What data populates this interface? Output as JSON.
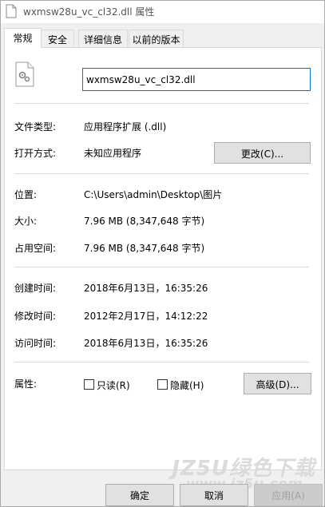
{
  "window": {
    "title": "wxmsw28u_vc_cl32.dll 属性"
  },
  "tabs": [
    {
      "label": "常规"
    },
    {
      "label": "安全"
    },
    {
      "label": "详细信息"
    },
    {
      "label": "以前的版本"
    }
  ],
  "general": {
    "file_name": "wxmsw28u_vc_cl32.dll",
    "file_type_label": "文件类型:",
    "file_type_value": "应用程序扩展 (.dll)",
    "open_with_label": "打开方式:",
    "open_with_value": "未知应用程序",
    "change_button": "更改(C)...",
    "location_label": "位置:",
    "location_value": "C:\\Users\\admin\\Desktop\\图片",
    "size_label": "大小:",
    "size_value": "7.96 MB (8,347,648 字节)",
    "size_on_disk_label": "占用空间:",
    "size_on_disk_value": "7.96 MB (8,347,648 字节)",
    "created_label": "创建时间:",
    "created_value": "2018年6月13日，16:35:26",
    "modified_label": "修改时间:",
    "modified_value": "2012年2月17日，14:12:22",
    "accessed_label": "访问时间:",
    "accessed_value": "2018年6月13日，16:35:26",
    "attributes_label": "属性:",
    "readonly_label": "只读(R)",
    "hidden_label": "隐藏(H)",
    "advanced_button": "高级(D)..."
  },
  "footer": {
    "ok_button": "确定",
    "cancel_button": "取消",
    "apply_button": "应用(A)"
  },
  "watermark": {
    "brand": "JZ5U绿色下载",
    "url": "www.jz5u.com"
  },
  "colors": {
    "accent_border": "#0078d7",
    "window_bg": "#f0f0f0",
    "panel_bg": "#ffffff"
  }
}
